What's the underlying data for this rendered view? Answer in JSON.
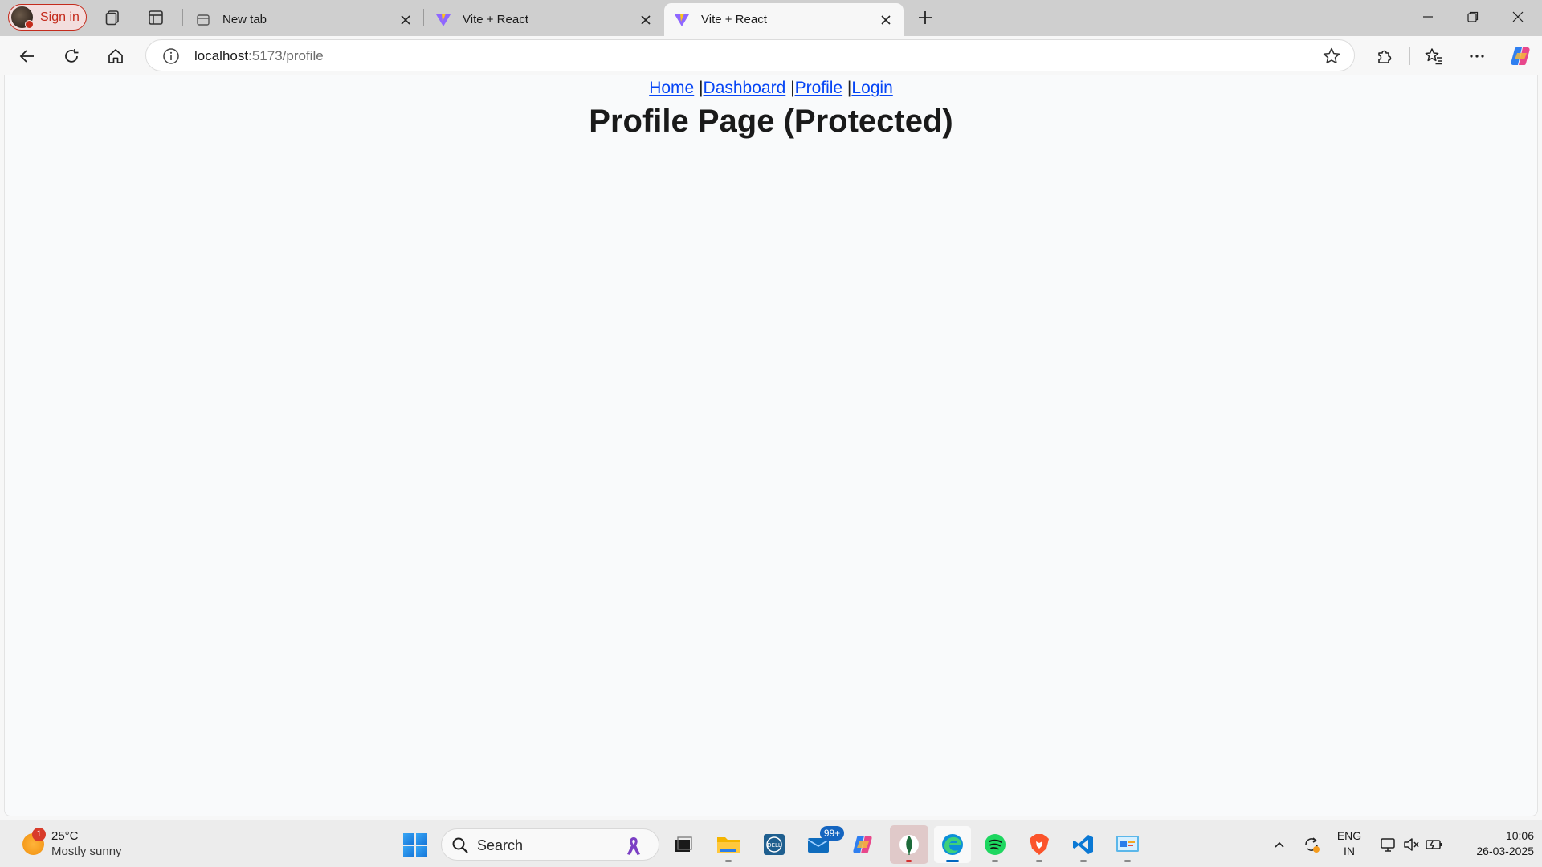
{
  "browser": {
    "profile_label": "Sign in",
    "tabs": [
      {
        "title": "New tab"
      },
      {
        "title": "Vite + React"
      },
      {
        "title": "Vite + React"
      }
    ],
    "address": {
      "host": "localhost",
      "rest": ":5173/profile"
    }
  },
  "page": {
    "nav": {
      "home": "Home",
      "sep1": " |",
      "dashboard": "Dashboard",
      "sep2": " |",
      "profile": "Profile",
      "sep3": " |",
      "login": "Login"
    },
    "title": "Profile Page (Protected)"
  },
  "taskbar": {
    "weather": {
      "badge": "1",
      "temp": "25°C",
      "condition": "Mostly sunny"
    },
    "search_label": "Search",
    "mail_badge": "99+",
    "lang": {
      "line1": "ENG",
      "line2": "IN"
    },
    "clock": {
      "time": "10:06",
      "date": "26-03-2025"
    }
  },
  "colors": {
    "link": "#0645f5",
    "profile_accent": "#c42b1c",
    "page_bg": "#f9fafb"
  }
}
